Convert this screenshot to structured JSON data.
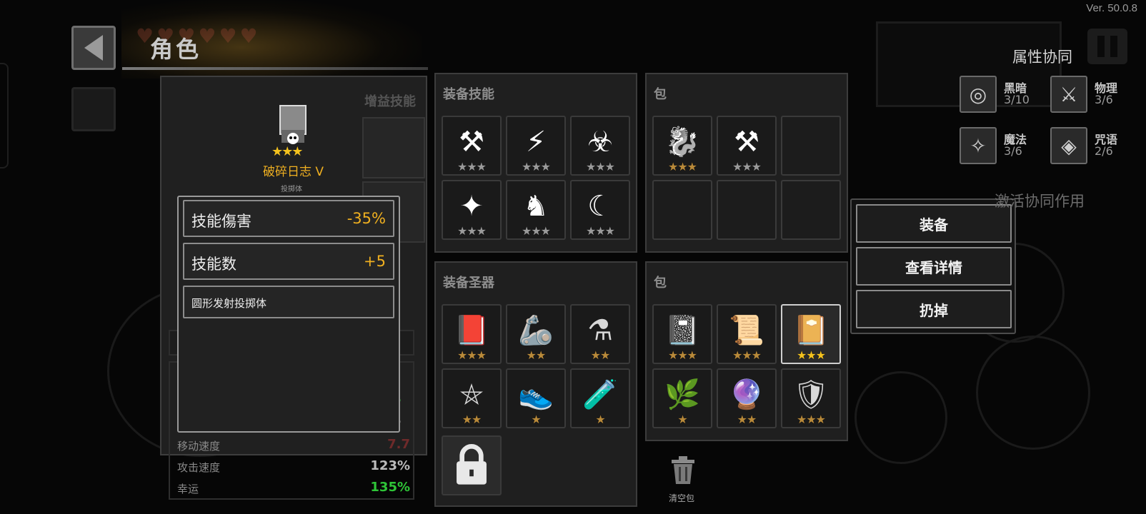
{
  "version": "Ver. 50.0.8",
  "header": {
    "title": "角色"
  },
  "character": {
    "buff_skills_title": "增益技能",
    "name": "破碎日志 V",
    "subtitle": "投掷体",
    "stats": [
      {
        "label": "移动速度",
        "value": "7.7",
        "tone": "red"
      },
      {
        "label": "攻击速度",
        "value": "123%",
        "tone": "normal"
      },
      {
        "label": "幸运",
        "value": "135%",
        "tone": "green"
      }
    ],
    "partial_values": [
      "%",
      "%"
    ]
  },
  "tooltip": {
    "stat1": {
      "label": "技能傷害",
      "value": "-35%"
    },
    "stat2": {
      "label": "技能数",
      "value": "+5"
    },
    "description": "圆形发射投掷体"
  },
  "equip_skills": {
    "title": "装备技能",
    "slots": [
      {
        "icon": "hammer-arrow-icon",
        "glyph": "⚒",
        "stars": "★★★",
        "bright_stars": 0
      },
      {
        "icon": "lightning-figure-icon",
        "glyph": "⚡",
        "stars": "★★★",
        "bright_stars": 0
      },
      {
        "icon": "biohazard-icon",
        "glyph": "☣",
        "stars": "★★★",
        "bright_stars": 0
      },
      {
        "icon": "shuriken-icon",
        "glyph": "✦",
        "stars": "★★★",
        "bright_stars": 0
      },
      {
        "icon": "tornado-figure-icon",
        "glyph": "♞",
        "stars": "★★★",
        "bright_stars": 0
      },
      {
        "icon": "crescent-slash-icon",
        "glyph": "☾",
        "stars": "★★★",
        "bright_stars": 0
      }
    ]
  },
  "skill_bag": {
    "title": "包",
    "slots": [
      {
        "icon": "dragon-icon",
        "glyph": "🐉",
        "stars": "★★★",
        "partial": true
      },
      {
        "icon": "hammer-arrow-icon",
        "glyph": "⚒",
        "stars": "★★★"
      },
      {
        "icon": "",
        "glyph": "",
        "stars": ""
      },
      {
        "icon": "",
        "glyph": "",
        "stars": ""
      },
      {
        "icon": "",
        "glyph": "",
        "stars": ""
      },
      {
        "icon": "",
        "glyph": "",
        "stars": ""
      }
    ]
  },
  "equip_relics": {
    "title": "装备圣器",
    "slots": [
      {
        "icon": "purple-book-icon",
        "glyph": "📕",
        "stars": "★★★"
      },
      {
        "icon": "spiked-gauntlet-icon",
        "glyph": "🦾",
        "stars": "★★"
      },
      {
        "icon": "potion-flask-icon",
        "glyph": "⚗",
        "stars": "★★"
      },
      {
        "icon": "pentagram-circle-icon",
        "glyph": "⛤",
        "stars": "★★"
      },
      {
        "icon": "red-boot-icon",
        "glyph": "👟",
        "stars": "★"
      },
      {
        "icon": "red-potion-icon",
        "glyph": "🧪",
        "stars": "★"
      }
    ],
    "lock_icon": "lock-icon"
  },
  "relic_bag": {
    "title": "包",
    "slots": [
      {
        "icon": "purple-tome-icon",
        "glyph": "📓",
        "stars": "★★★"
      },
      {
        "icon": "scroll-icon",
        "glyph": "📜",
        "stars": "★★★"
      },
      {
        "icon": "broken-journal-icon",
        "glyph": "📔",
        "stars": "★★★",
        "selected": true
      },
      {
        "icon": "branch-icon",
        "glyph": "🌿",
        "stars": "★"
      },
      {
        "icon": "dark-orb-icon",
        "glyph": "🔮",
        "stars": "★★"
      },
      {
        "icon": "banner-shield-icon",
        "glyph": "🛡",
        "stars": "★★★"
      }
    ]
  },
  "context_menu": {
    "equip": "装备",
    "details": "查看详情",
    "discard": "扔掉"
  },
  "synergy": {
    "title": "属性协同",
    "items": [
      {
        "name": "黑暗",
        "count": "3/10",
        "icon": "dark-swirl-icon",
        "glyph": "◎"
      },
      {
        "name": "物理",
        "count": "3/6",
        "icon": "sword-icon",
        "glyph": "⚔"
      },
      {
        "name": "魔法",
        "count": "3/6",
        "icon": "star-diamond-icon",
        "glyph": "✧"
      },
      {
        "name": "咒语",
        "count": "2/6",
        "icon": "eye-rune-icon",
        "glyph": "◈"
      }
    ],
    "activate": "激活协同作用"
  },
  "trash": {
    "label": "清空包"
  }
}
